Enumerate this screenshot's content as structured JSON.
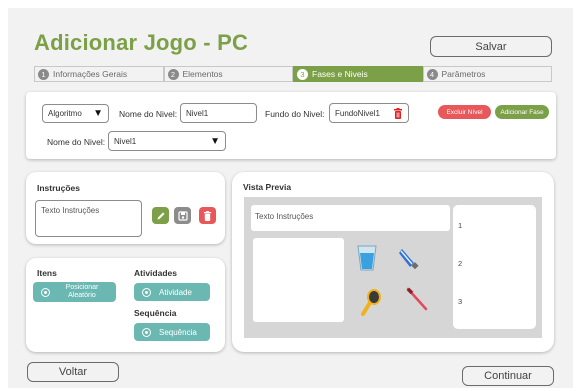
{
  "page": {
    "title": "Adicionar Jogo - PC"
  },
  "header": {
    "save_label": "Salvar"
  },
  "steps": [
    {
      "num": "1",
      "label": "Informações Gerais",
      "active": false
    },
    {
      "num": "2",
      "label": "Elementos",
      "active": false
    },
    {
      "num": "3",
      "label": "Fases e Niveis",
      "active": true
    },
    {
      "num": "4",
      "label": "Parâmetros",
      "active": false
    }
  ],
  "level_panel": {
    "algorithm_select": "Algoritmo",
    "level_name_label": "Nome do Nivel:",
    "level_name_value": "Nivel1",
    "background_label": "Fundo do Nivel:",
    "background_value": "FundoNivel1",
    "delete_level_label": "Excluir Nível",
    "add_phase_label": "Adicionar Fase",
    "level_name_select_label": "Nome do Nivel:",
    "level_name_select_value": "Nivel1"
  },
  "instructions": {
    "title": "Instruções",
    "placeholder": "Texto Instruções"
  },
  "items_panel": {
    "items_title": "Itens",
    "items_button": "Posicionar Aleatório",
    "activities_title": "Atividades",
    "activities_button": "Atividade",
    "sequence_title": "Sequência",
    "sequence_button": "Sequência"
  },
  "preview": {
    "title": "Vista Previa",
    "instructions_text": "Texto Instruções",
    "list_numbers": [
      "1",
      "2",
      "3"
    ]
  },
  "footer": {
    "back_label": "Voltar",
    "continue_label": "Continuar"
  },
  "colors": {
    "accent_green": "#7ca047",
    "danger": "#e8575a",
    "teal": "#6bb8b3",
    "gray_step": "#8a8a8a"
  }
}
